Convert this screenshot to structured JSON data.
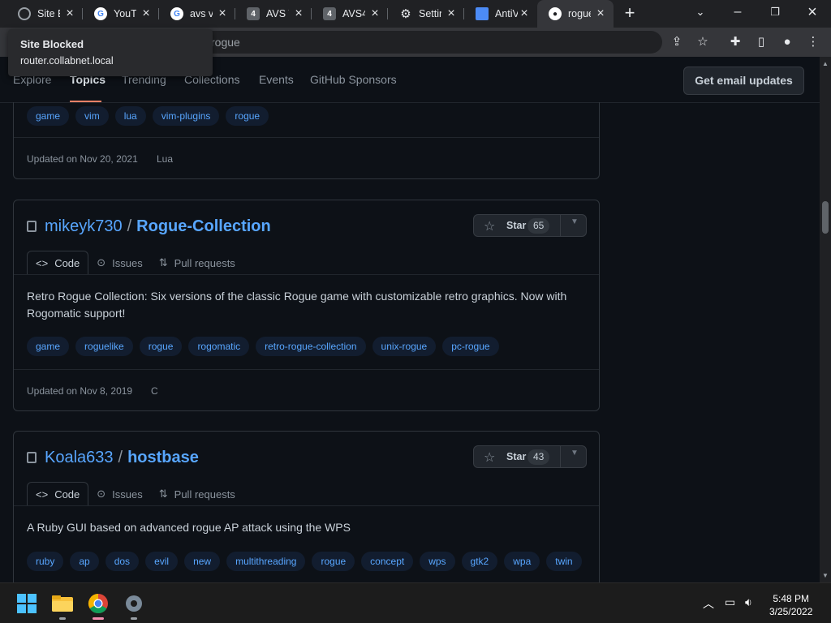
{
  "browser": {
    "tabs": [
      {
        "title": "Site Blocked",
        "favicon": "globe-icon",
        "color": "#9aa0a6"
      },
      {
        "title": "YouTube",
        "favicon": "google-icon",
        "color": "#4285f4"
      },
      {
        "title": "avs vi",
        "favicon": "google-icon",
        "color": "#4285f4"
      },
      {
        "title": "AVS V",
        "favicon": "avs-icon",
        "color": "#5f6368"
      },
      {
        "title": "AVS4",
        "favicon": "avs-icon",
        "color": "#5f6368"
      },
      {
        "title": "Settings",
        "favicon": "gear-icon",
        "color": "#9aa0a6"
      },
      {
        "title": "AntiV",
        "favicon": "window-icon",
        "color": "#4c8bf5"
      },
      {
        "title": "rogue",
        "favicon": "github-icon",
        "color": "#ffffff"
      }
    ],
    "url": "rogue",
    "popup": {
      "title": "Site Blocked",
      "subtitle": "router.collabnet.local"
    }
  },
  "subnav": {
    "items": [
      "Explore",
      "Topics",
      "Trending",
      "Collections",
      "Events",
      "GitHub Sponsors"
    ],
    "active": "Topics",
    "email_button": "Get email updates"
  },
  "repos": [
    {
      "topics": [
        "game",
        "vim",
        "lua",
        "vim-plugins",
        "rogue"
      ],
      "updated": "Updated on Nov 20, 2021",
      "language": "Lua"
    },
    {
      "owner": "mikeyk730",
      "name": "Rogue-Collection",
      "star_label": "Star",
      "stars": "65",
      "tabs": [
        "Code",
        "Issues",
        "Pull requests"
      ],
      "description": "Retro Rogue Collection: Six versions of the classic Rogue game with customizable retro graphics. Now with Rogomatic support!",
      "topics": [
        "game",
        "roguelike",
        "rogue",
        "rogomatic",
        "retro-rogue-collection",
        "unix-rogue",
        "pc-rogue"
      ],
      "updated": "Updated on Nov 8, 2019",
      "language": "C"
    },
    {
      "owner": "Koala633",
      "name": "hostbase",
      "star_label": "Star",
      "stars": "43",
      "tabs": [
        "Code",
        "Issues",
        "Pull requests"
      ],
      "description": "A Ruby GUI based on advanced rogue AP attack using the WPS",
      "topics": [
        "ruby",
        "ap",
        "dos",
        "evil",
        "new",
        "multithreading",
        "rogue",
        "concept",
        "wps",
        "gtk2",
        "wpa",
        "twin"
      ]
    }
  ],
  "taskbar": {
    "time": "5:48 PM",
    "date": "3/25/2022"
  }
}
